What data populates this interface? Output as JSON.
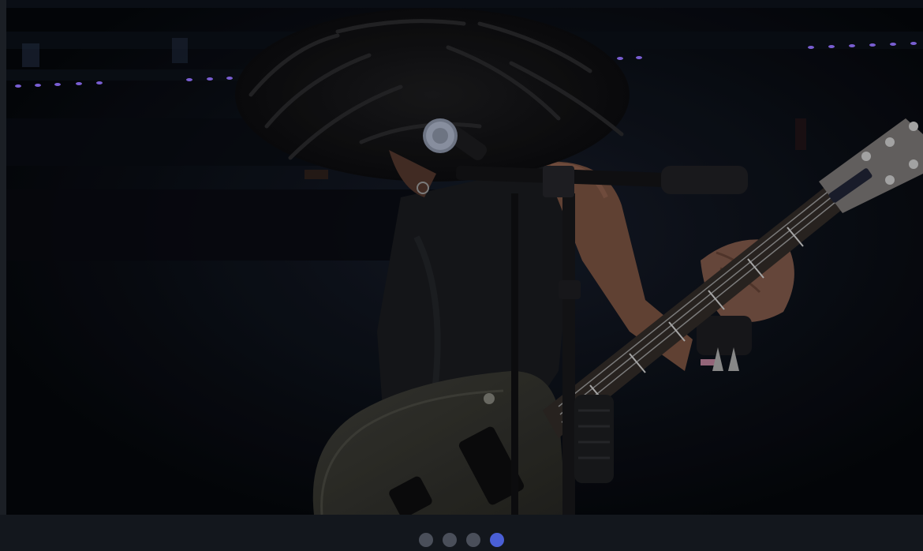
{
  "image": {
    "alt": "",
    "subject": "guitarist-with-microphone"
  },
  "carousel": {
    "slide_count": 4,
    "active_index": 3,
    "dot_color": "#4a4f5a",
    "active_dot_color": "#4a5fd6"
  }
}
